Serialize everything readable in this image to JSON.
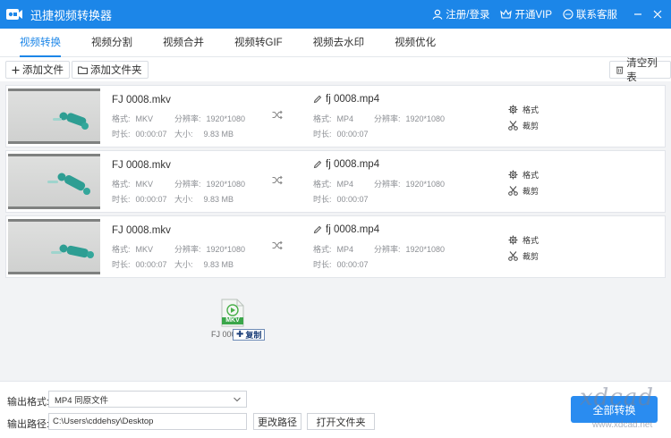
{
  "app": {
    "title": "迅捷视频转换器",
    "register_login": "注册/登录",
    "open_vip": "开通VIP",
    "contact_support": "联系客服",
    "accent_color": "#1c86e8"
  },
  "tabs": [
    {
      "label": "视频转换",
      "active": true
    },
    {
      "label": "视频分割",
      "active": false
    },
    {
      "label": "视频合并",
      "active": false
    },
    {
      "label": "视频转GIF",
      "active": false
    },
    {
      "label": "视频去水印",
      "active": false
    },
    {
      "label": "视频优化",
      "active": false
    }
  ],
  "toolbar": {
    "add_file": "添加文件",
    "add_folder": "添加文件夹",
    "clear_list": "清空列表"
  },
  "files": [
    {
      "source": {
        "name": "FJ 0008.mkv",
        "format_label": "格式:",
        "format": "MKV",
        "resolution_label": "分辨率:",
        "resolution": "1920*1080",
        "duration_label": "时长:",
        "duration": "00:00:07",
        "size_label": "大小:",
        "size": "9.83 MB"
      },
      "output": {
        "name": "fj 0008.mp4",
        "format_label": "格式:",
        "format": "MP4",
        "resolution_label": "分辨率:",
        "resolution": "1920*1080",
        "duration_label": "时长:",
        "duration": "00:00:07"
      },
      "actions": {
        "format": "格式",
        "cut": "裁剪"
      }
    },
    {
      "source": {
        "name": "FJ 0008.mkv",
        "format_label": "格式:",
        "format": "MKV",
        "resolution_label": "分辨率:",
        "resolution": "1920*1080",
        "duration_label": "时长:",
        "duration": "00:00:07",
        "size_label": "大小:",
        "size": "9.83 MB"
      },
      "output": {
        "name": "fj 0008.mp4",
        "format_label": "格式:",
        "format": "MP4",
        "resolution_label": "分辨率:",
        "resolution": "1920*1080",
        "duration_label": "时长:",
        "duration": "00:00:07"
      },
      "actions": {
        "format": "格式",
        "cut": "裁剪"
      }
    },
    {
      "source": {
        "name": "FJ 0008.mkv",
        "format_label": "格式:",
        "format": "MKV",
        "resolution_label": "分辨率:",
        "resolution": "1920*1080",
        "duration_label": "时长:",
        "duration": "00:00:07",
        "size_label": "大小:",
        "size": "9.83 MB"
      },
      "output": {
        "name": "fj 0008.mp4",
        "format_label": "格式:",
        "format": "MP4",
        "resolution_label": "分辨率:",
        "resolution": "1920*1080",
        "duration_label": "时长:",
        "duration": "00:00:07"
      },
      "actions": {
        "format": "格式",
        "cut": "裁剪"
      }
    }
  ],
  "drag": {
    "file_badge": "MKV",
    "file_name": "FJ 000",
    "copy_tip": "复制"
  },
  "bottom": {
    "output_format_label": "输出格式:",
    "output_format_value": "MP4  同原文件",
    "output_path_label": "输出路径:",
    "output_path_value": "C:\\Users\\cddehsy\\Desktop",
    "change_path": "更改路径",
    "open_folder": "打开文件夹",
    "convert_all": "全部转换"
  },
  "watermark": {
    "text": "xdcad",
    "domain": "www.xdcad.net"
  }
}
